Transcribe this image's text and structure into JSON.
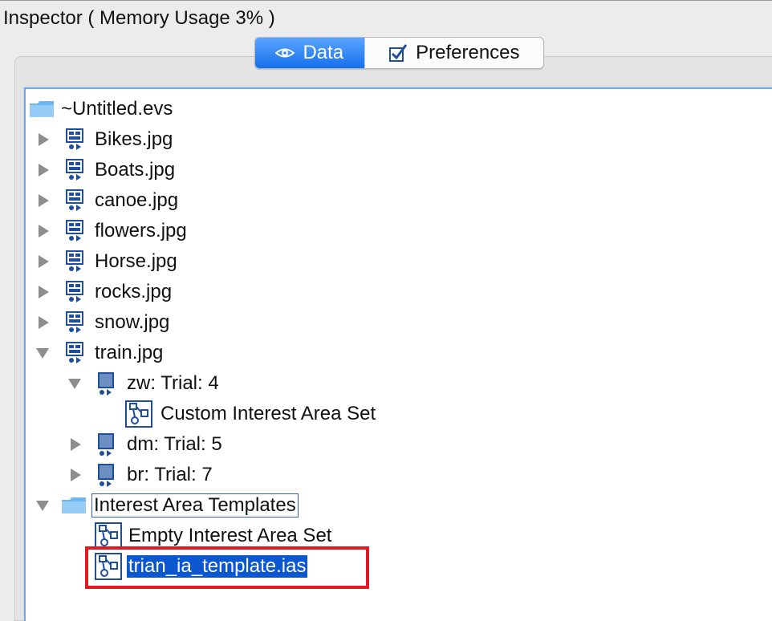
{
  "window": {
    "title": "Inspector ( Memory Usage 3% )"
  },
  "tabs": [
    {
      "label": "Data",
      "icon": "eye-icon",
      "active": true
    },
    {
      "label": "Preferences",
      "icon": "checkbox-icon",
      "active": false
    }
  ],
  "tree": {
    "root": {
      "label": "~Untitled.evs",
      "icon": "folder-icon"
    },
    "images": [
      {
        "label": "Bikes.jpg",
        "expanded": false
      },
      {
        "label": "Boats.jpg",
        "expanded": false
      },
      {
        "label": "canoe.jpg",
        "expanded": false
      },
      {
        "label": "flowers.jpg",
        "expanded": false
      },
      {
        "label": "Horse.jpg",
        "expanded": false
      },
      {
        "label": "rocks.jpg",
        "expanded": false
      },
      {
        "label": "snow.jpg",
        "expanded": false
      },
      {
        "label": "train.jpg",
        "expanded": true
      }
    ],
    "trials": [
      {
        "label": "zw: Trial: 4",
        "expanded": true
      },
      {
        "label": "dm: Trial: 5",
        "expanded": false
      },
      {
        "label": "br: Trial: 7",
        "expanded": false
      }
    ],
    "custom_set": {
      "label": "Custom Interest Area Set"
    },
    "templates_folder": {
      "label": "Interest Area Templates",
      "expanded": true
    },
    "templates": [
      {
        "label": "Empty Interest Area Set",
        "selected": false
      },
      {
        "label": "trian_ia_template.ias",
        "selected": true
      }
    ]
  },
  "colors": {
    "accent": "#0b57d0",
    "highlight_box": "#e01a22",
    "tree_border": "#75a7e4"
  }
}
